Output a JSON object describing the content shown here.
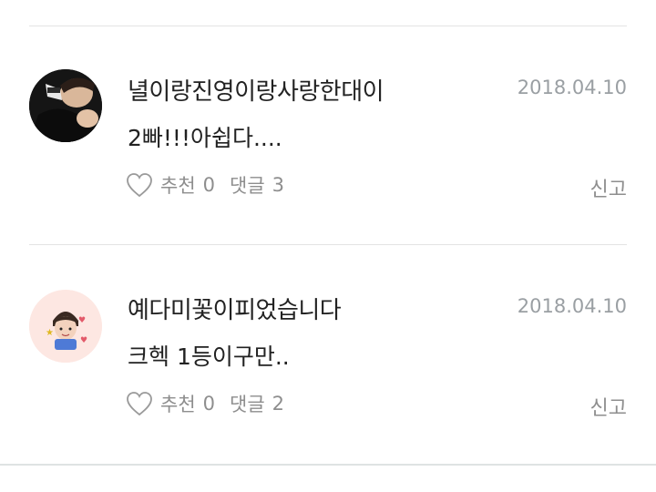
{
  "comments": [
    {
      "author": "녈이랑진영이랑사랑한대이",
      "date": "2018.04.10",
      "text": "2빠!!!아쉽다....",
      "like_label": "추천",
      "like_count": "0",
      "reply_label": "댓글",
      "reply_count": "3",
      "report_label": "신고",
      "avatar_icon": "user-photo-dark",
      "avatar_bg": "#1a1a1a"
    },
    {
      "author": "예다미꽃이피었습니다",
      "date": "2018.04.10",
      "text": "크헥 1등이구만..",
      "like_label": "추천",
      "like_count": "0",
      "reply_label": "댓글",
      "reply_count": "2",
      "report_label": "신고",
      "avatar_icon": "user-sticker-pink",
      "avatar_bg": "#fde7e2"
    }
  ],
  "colors": {
    "text": "#222222",
    "meta": "#9a9fa3",
    "action": "#8e8e8e",
    "divider": "#e3e3e3"
  }
}
